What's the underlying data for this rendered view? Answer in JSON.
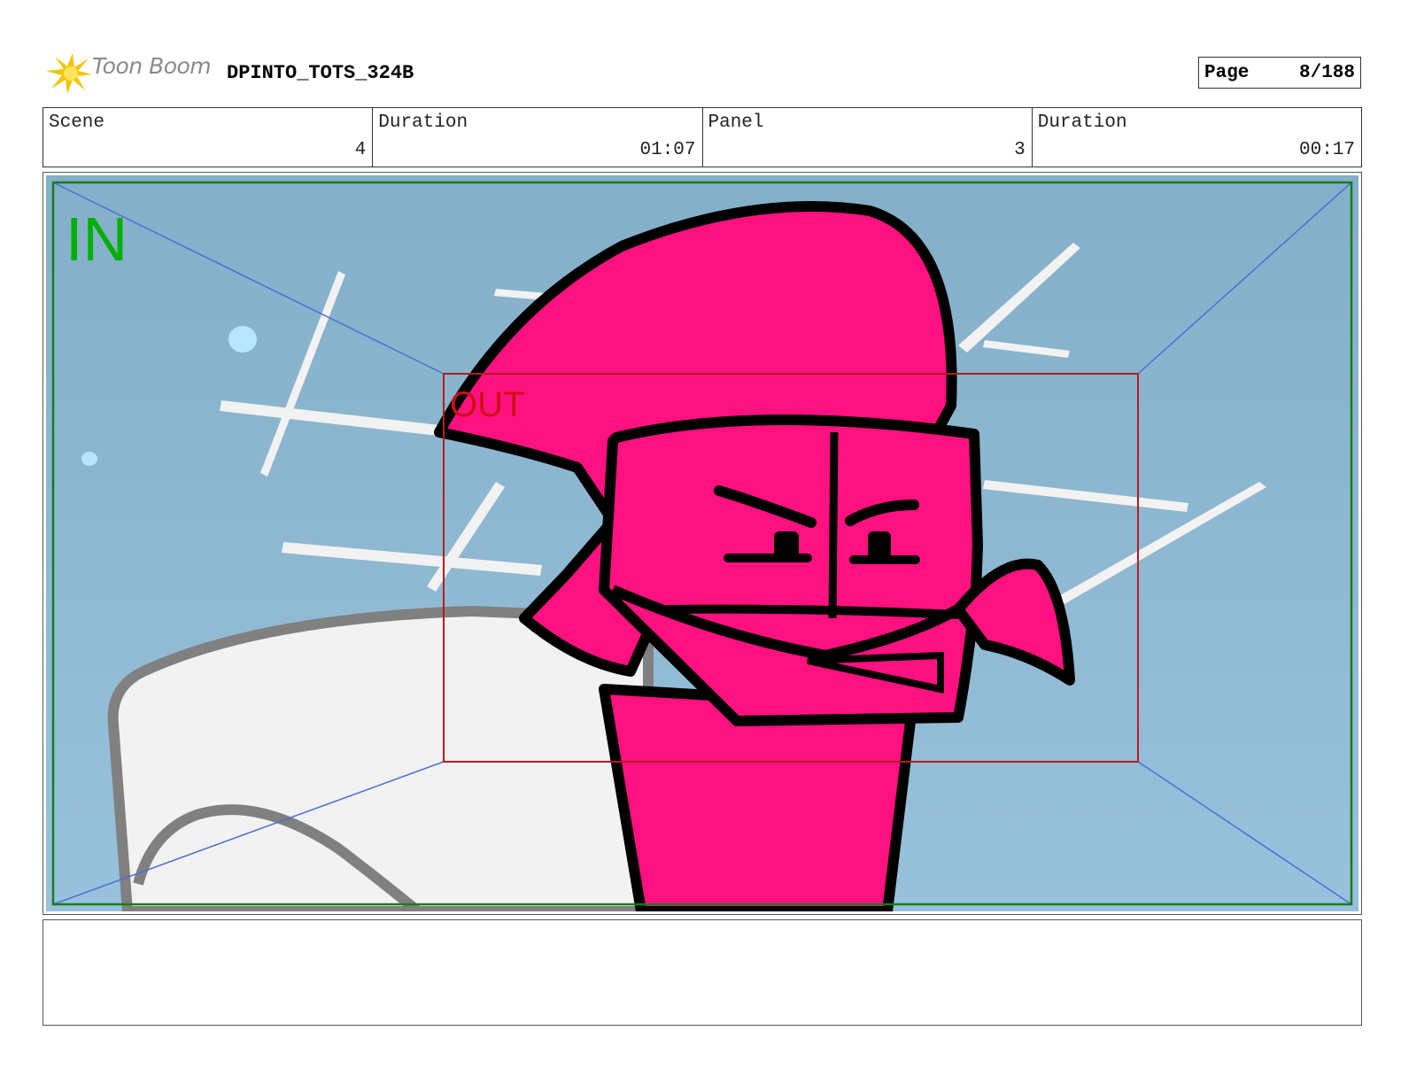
{
  "header": {
    "logo_text": "Toon Boom",
    "project_title": "DPINTO_TOTS_324B",
    "page_label": "Page",
    "page_value": "8/188"
  },
  "info": {
    "scene_label": "Scene",
    "scene_value": "4",
    "scene_duration_label": "Duration",
    "scene_duration_value": "01:07",
    "panel_label": "Panel",
    "panel_value": "3",
    "panel_duration_label": "Duration",
    "panel_duration_value": "00:17"
  },
  "frame": {
    "in_label": "IN",
    "out_label": "OUT",
    "colors": {
      "sky_top": "#84afc8",
      "sky_bottom": "#98c1dc",
      "character": "#ff1180",
      "in_frame": "#1a7a1a",
      "in_text": "#00b000",
      "out_frame": "#b81c1c",
      "out_text": "#cc1111",
      "guide_lines": "#4a6fd8"
    }
  },
  "notes": {
    "text": ""
  }
}
